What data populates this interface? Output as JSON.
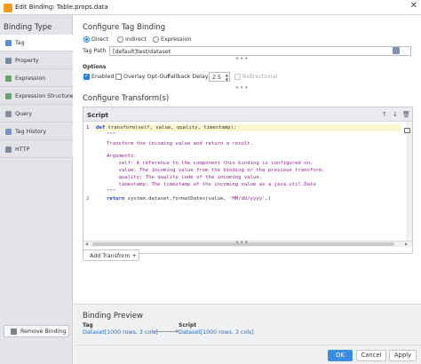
{
  "window": {
    "title": "Edit Binding: Table.props.data",
    "close_glyph": "✕"
  },
  "sidebar": {
    "title": "Binding Type",
    "items": [
      {
        "label": "Tag",
        "color": "#5b8ccf"
      },
      {
        "label": "Property",
        "color": "#7e8aa0"
      },
      {
        "label": "Expression",
        "color": "#6f9f6f"
      },
      {
        "label": "Expression Structure",
        "color": "#6f9f6f"
      },
      {
        "label": "Query",
        "color": "#888fa0"
      },
      {
        "label": "Tag History",
        "color": "#7a93b6"
      },
      {
        "label": "HTTP",
        "color": "#7f8a9c"
      }
    ],
    "active_index": 0,
    "remove_label": "Remove Binding"
  },
  "config": {
    "title": "Configure Tag Binding",
    "modes": [
      "Direct",
      "Indirect",
      "Expression"
    ],
    "selected_mode": "Direct",
    "tag_path_label": "Tag Path",
    "tag_path_value": "[default]test/dataset",
    "options_label": "Options",
    "enabled_label": "Enabled",
    "enabled": true,
    "overlay_label": "Overlay Opt-Out",
    "overlay": false,
    "fallback_label": "Fallback Delay",
    "fallback_value": "2.5",
    "bidirectional_label": "Bidirectional",
    "bidirectional": false
  },
  "transforms": {
    "title": "Configure Transform(s)",
    "script_title": "Script",
    "code": {
      "def": "def",
      "signature": " transform(self, value, quality, timestamp):",
      "doc_open": "\"\"\"",
      "doc_1": "Transform the incoming value and return a result.",
      "doc_2": "Arguments:",
      "doc_3": "    self: A reference to the component this binding is configured on.",
      "doc_4": "    value: The incoming value from the binding or the previous transform.",
      "doc_5": "    quality: The quality code of the incoming value.",
      "doc_6": "    timestamp: The timestamp of the incoming value as a java.util.Date",
      "doc_close": "\"\"\"",
      "return_kw": "return",
      "return_body": " system.dataset.formatDates(value, ",
      "return_str": "'MM/dd/yyyy'",
      "return_end": ",)",
      "line1": "1",
      "line2": "2"
    },
    "add_label": "Add Transform +"
  },
  "preview": {
    "title": "Binding Preview",
    "tag_label": "Tag",
    "tag_value": "Dataset[1000 rows, 3 cols]",
    "script_label": "Script",
    "script_value": "Dataset[1000 rows, 3 cols]"
  },
  "footer": {
    "ok": "OK",
    "cancel": "Cancel",
    "apply": "Apply"
  }
}
